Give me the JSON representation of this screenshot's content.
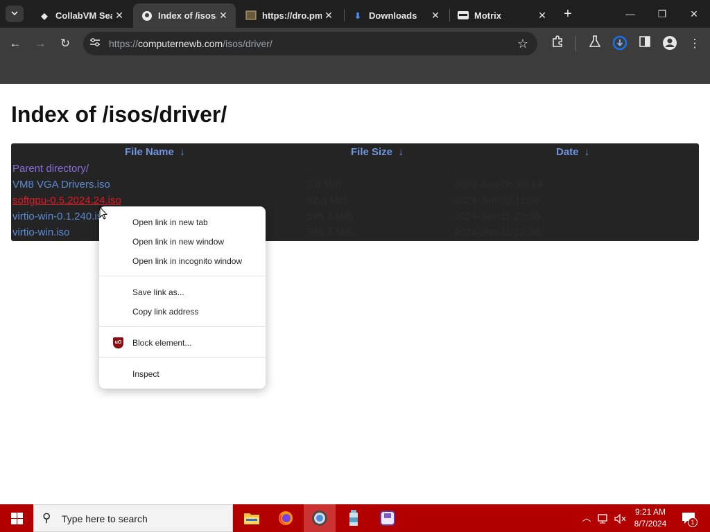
{
  "browser": {
    "tabs": [
      {
        "title": "CollabVM Sear",
        "favicon": "collabvm-icon",
        "active": false
      },
      {
        "title": "Index of /isos/d",
        "favicon": "github-icon",
        "active": true
      },
      {
        "title": "https://dro.pm",
        "favicon": "image-icon",
        "active": false
      },
      {
        "title": "Downloads",
        "favicon": "download-icon",
        "active": false
      },
      {
        "title": "Motrix",
        "favicon": "motrix-icon",
        "active": false
      }
    ],
    "url_scheme": "https://",
    "url_host": "computernewb.com",
    "url_path": "/isos/driver/"
  },
  "page": {
    "heading": "Index of /isos/driver/",
    "columns": [
      {
        "label": "File Name",
        "sort_icon": "↓"
      },
      {
        "label": "File Size",
        "sort_icon": "↓"
      },
      {
        "label": "Date",
        "sort_icon": "↓"
      }
    ],
    "rows": [
      {
        "name": "Parent directory/",
        "size": "-",
        "date": "-"
      },
      {
        "name": "VM8 VGA Drivers.iso",
        "size": "2.6 MiB",
        "date": "2023-Aug-06 20:14"
      },
      {
        "name": "softgpu-0.5.2024.24.iso",
        "size": "42.0 MiB",
        "date": "2024-Jun-02 11:56"
      },
      {
        "name": "virtio-win-0.1.240.iso",
        "size": "598.3 MiB",
        "date": "2024-Jan-11 22:38"
      },
      {
        "name": "virtio-win.iso",
        "size": "598.3 MiB",
        "date": "2024-Jan-11 22:38"
      }
    ]
  },
  "context_menu": {
    "items": [
      "Open link in new tab",
      "Open link in new window",
      "Open link in incognito window",
      "Save link as...",
      "Copy link address",
      "Block element...",
      "Inspect"
    ],
    "ublock_icon_text": "uO"
  },
  "taskbar": {
    "search_placeholder": "Type here to search",
    "time": "9:21 AM",
    "date": "8/7/2024",
    "notification_count": "1",
    "accent": "#b20000"
  }
}
